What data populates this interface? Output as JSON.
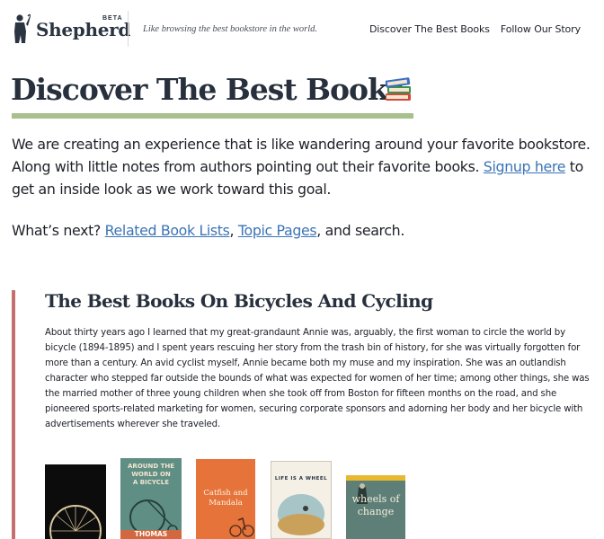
{
  "header": {
    "logo_text": "Shepherd",
    "logo_badge": "BETA",
    "logo_icon": "shepherd-silhouette-icon",
    "tagline": "Like browsing the best bookstore in the world.",
    "nav": [
      {
        "label": "Discover The Best Books"
      },
      {
        "label": "Follow Our Story"
      }
    ]
  },
  "hero": {
    "title": "Discover The Best Books",
    "title_icon": "books-emoji-icon",
    "intro_before_link": "We are creating an experience that is like wandering around your favorite bookstore. Along with little notes from authors pointing out their favorite books. ",
    "intro_link": "Signup here",
    "intro_after_link": " to get an inside look as we work toward this goal.",
    "next_prefix": "What’s next? ",
    "next_link_1": "Related Book Lists",
    "next_sep": ", ",
    "next_link_2": "Topic Pages",
    "next_suffix": ", and search."
  },
  "article": {
    "title": "The Best Books On Bicycles And Cycling",
    "body": "About thirty years ago I learned that my great-grandaunt Annie was, arguably, the first woman to circle the world by bicycle (1894-1895) and I spent years rescuing her story from the trash bin of history, for she was virtually forgotten for more than a century. An avid cyclist myself, Annie became both my muse and my inspiration. She was an outlandish character who stepped far outside the bounds of what was expected for women of her time; among other things, she was the married mother of three young children when she took off from Boston for fifteen months on the road, and she pioneered sports-related marketing for women, securing corporate sponsors and adorning her body and her bicycle with advertisements wherever she traveled."
  },
  "books": [
    {
      "cover_text": ""
    },
    {
      "cover_text": "AROUND THE\nWORLD ON\nA BICYCLE",
      "author_text": "THOMAS"
    },
    {
      "cover_text": "Catfish and\nMandala"
    },
    {
      "cover_text": "LIFE IS A WHEEL"
    },
    {
      "cover_text": "wheels of\nchange"
    }
  ],
  "colors": {
    "accent_green": "#a7c08c",
    "link_blue": "#3b74b6",
    "article_bar": "#c56f6e"
  }
}
